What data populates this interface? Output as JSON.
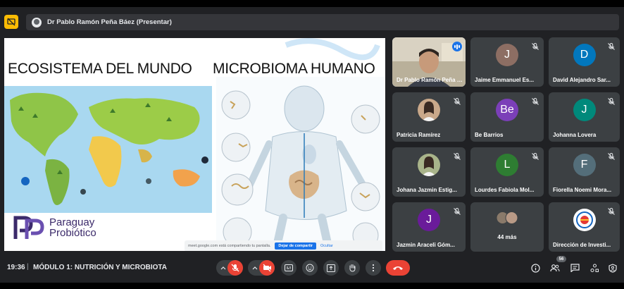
{
  "presenter": {
    "name": "Dr Pablo Ramón Peña Báez (Presentar)"
  },
  "slide": {
    "left_title": "ECOSISTEMA DEL MUNDO",
    "right_title": "MICROBIOMA HUMANO",
    "logo_line1": "Paraguay",
    "logo_line2": "Probiótico",
    "share_notice": "meet.google.com está compartiendo tu pantalla.",
    "share_stop": "Dejar de compartir",
    "share_hide": "Ocultar"
  },
  "participants": [
    {
      "name": "Dr Pablo Ramón Peña Báez",
      "initial": "",
      "color": "",
      "kind": "video"
    },
    {
      "name": "Jaime Emmanuel Es...",
      "initial": "J",
      "color": "#8d6e63",
      "kind": "letter"
    },
    {
      "name": "David Alejandro Sar...",
      "initial": "D",
      "color": "#0277bd",
      "kind": "letter"
    },
    {
      "name": "Patricia Ramírez",
      "initial": "",
      "color": "#c9a88a",
      "kind": "photo"
    },
    {
      "name": "Be Barrios",
      "initial": "Be",
      "color": "#7b3fb8",
      "kind": "letter"
    },
    {
      "name": "Johanna Lovera",
      "initial": "J",
      "color": "#00897b",
      "kind": "letter"
    },
    {
      "name": "Johana Jazmin Estig...",
      "initial": "",
      "color": "#a9b48a",
      "kind": "photo"
    },
    {
      "name": "Lourdes Fabiola Mol...",
      "initial": "L",
      "color": "#2e7d32",
      "kind": "letter"
    },
    {
      "name": "Fiorella Noemi Mora...",
      "initial": "F",
      "color": "#546e7a",
      "kind": "letter"
    },
    {
      "name": "Jazmin Araceli Góm...",
      "initial": "J",
      "color": "#6a1b9a",
      "kind": "letter"
    },
    {
      "name": "44 más",
      "initial": "",
      "color": "",
      "kind": "more"
    },
    {
      "name": "Dirección de Investi...",
      "initial": "",
      "color": "#ffffff",
      "kind": "logo"
    }
  ],
  "bottom": {
    "time": "19:36",
    "separator": "|",
    "meeting": "MÓDULO 1: NUTRICIÓN Y MICROBIOTA",
    "people_count": "56"
  },
  "icons": {
    "present": "present-off-icon",
    "mic": "mic-off-icon",
    "camera": "camera-off-icon",
    "captions": "captions-icon",
    "emoji": "emoji-icon",
    "present_screen": "present-screen-icon",
    "hand": "raise-hand-icon",
    "more": "more-options-icon",
    "hangup": "hang-up-icon",
    "info": "info-icon",
    "people": "people-icon",
    "chat": "chat-icon",
    "activities": "activities-icon",
    "host": "host-controls-icon"
  }
}
